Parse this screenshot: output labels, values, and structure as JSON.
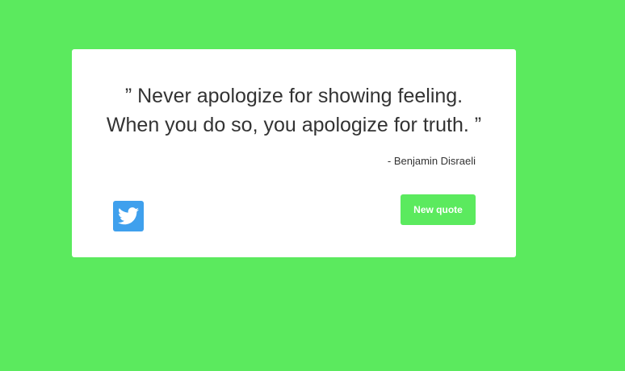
{
  "theme": {
    "background_color": "#5bea5e",
    "card_color": "#ffffff",
    "twitter_color": "#3fa0ed",
    "text_color": "#333333"
  },
  "quote": {
    "line1": "” Never apologize for showing feeling.",
    "line2": "When you do so, you apologize for truth. ”",
    "author": "- Benjamin Disraeli"
  },
  "actions": {
    "tweet_icon": "twitter-bird-icon",
    "new_quote_label": "New quote"
  }
}
